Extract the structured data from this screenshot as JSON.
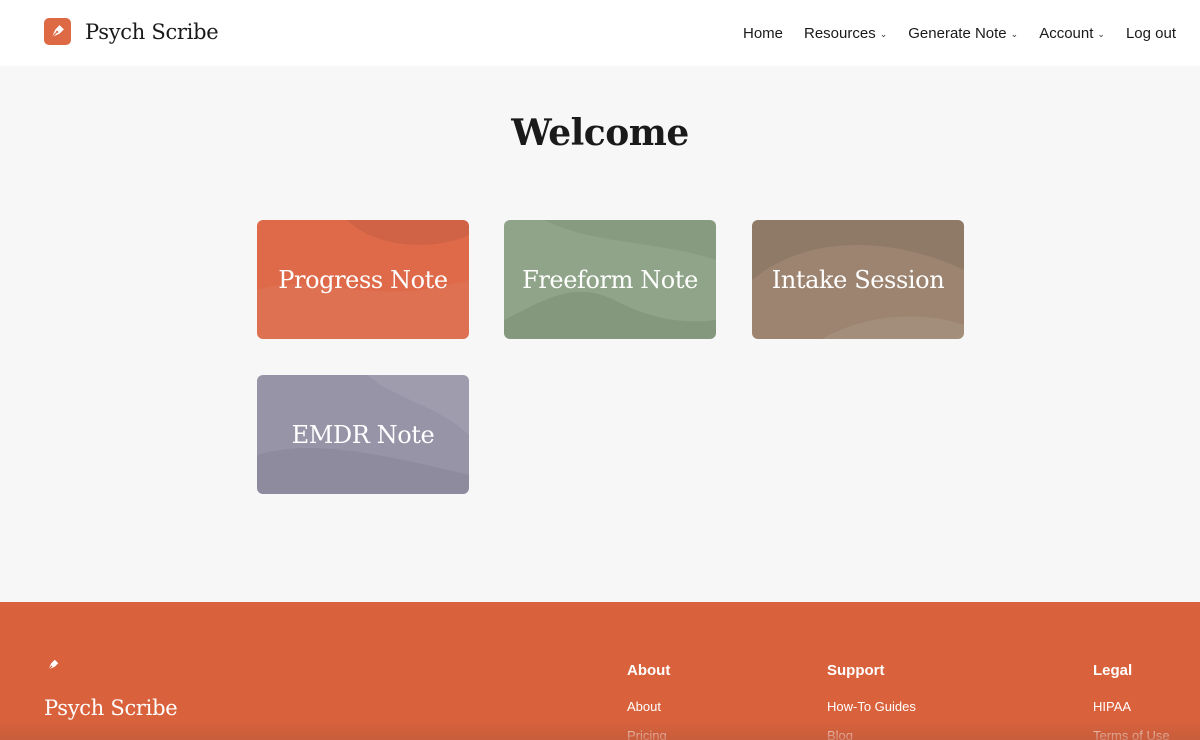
{
  "header": {
    "brand": "Psych Scribe",
    "nav": [
      {
        "label": "Home",
        "dropdown": false
      },
      {
        "label": "Resources",
        "dropdown": true
      },
      {
        "label": "Generate Note",
        "dropdown": true
      },
      {
        "label": "Account",
        "dropdown": true
      },
      {
        "label": "Log out",
        "dropdown": false
      }
    ]
  },
  "main": {
    "title": "Welcome",
    "cards": [
      {
        "label": "Progress Note",
        "color": "#de6a4a"
      },
      {
        "label": "Freeform Note",
        "color": "#8fa488"
      },
      {
        "label": "Intake Session",
        "color": "#9c8470"
      },
      {
        "label": "EMDR Note",
        "color": "#9794a8"
      }
    ]
  },
  "footer": {
    "brand": "Psych Scribe",
    "columns": [
      {
        "heading": "About",
        "links": [
          "About",
          "Pricing"
        ]
      },
      {
        "heading": "Support",
        "links": [
          "How-To Guides",
          "Blog"
        ]
      },
      {
        "heading": "Legal",
        "links": [
          "HIPAA",
          "Terms of Use"
        ]
      }
    ],
    "color": "#d9623c"
  },
  "icons": {
    "logo": "pen-nib-icon",
    "chevron": "chevron-down-icon"
  }
}
